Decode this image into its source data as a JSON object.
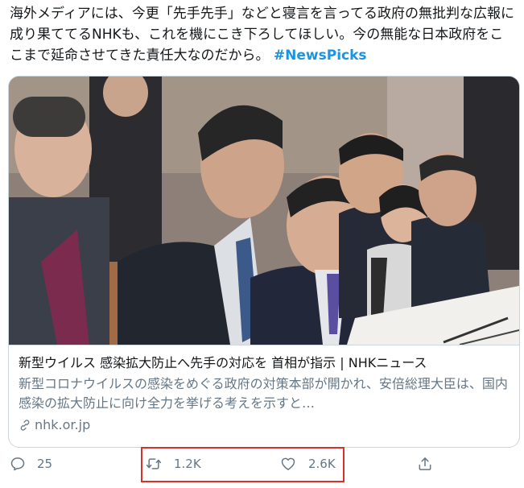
{
  "tweet": {
    "text": "海外メディアには、今更「先手先手」などと寝言を言ってる政府の無批判な広報に成り果ててるNHKも、これを機にこき下ろしてほしい。今の無能な日本政府をここまで延命させてきた責任大なのだから。 ",
    "hashtag": "#NewsPicks"
  },
  "card": {
    "image_icon": "photo-of-government-meeting",
    "title": "新型ウイルス 感染拡大防止へ先手の対応を 首相が指示 | NHKニュース",
    "description": "新型コロナウイルスの感染をめぐる政府の対策本部が開かれ、安倍総理大臣は、国内感染の拡大防止に向け全力を挙げる考えを示すと…",
    "domain": "nhk.or.jp",
    "domain_icon": "link-icon"
  },
  "actions": {
    "reply": {
      "icon": "reply-icon",
      "count": "25"
    },
    "retweet": {
      "icon": "retweet-icon",
      "count": "1.2K"
    },
    "like": {
      "icon": "heart-icon",
      "count": "2.6K"
    },
    "share": {
      "icon": "share-icon"
    }
  },
  "colors": {
    "accent": "#1b95e0",
    "secondary_text": "#657786",
    "highlight_border": "#d9302c"
  }
}
